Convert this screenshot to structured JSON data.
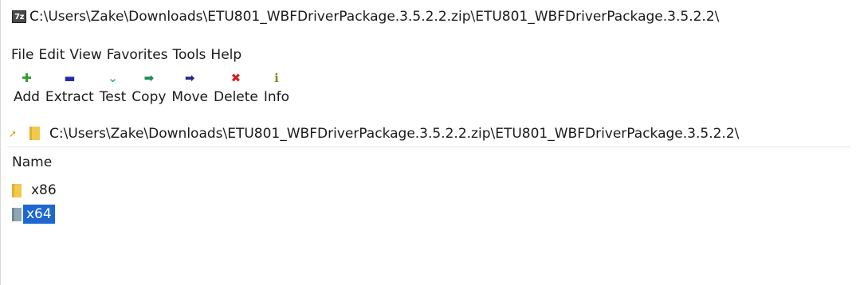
{
  "window": {
    "app_icon_text": "7z",
    "title": "C:\\Users\\Zake\\Downloads\\ETU801_WBFDriverPackage.3.5.2.2.zip\\ETU801_WBFDriverPackage.3.5.2.2\\"
  },
  "menu": {
    "items": [
      "File",
      "Edit",
      "View",
      "Favorites",
      "Tools",
      "Help"
    ]
  },
  "toolbar": {
    "buttons": [
      {
        "label": "Add",
        "icon": "add-icon",
        "glyph": "✚",
        "color": "#2e9e2e"
      },
      {
        "label": "Extract",
        "icon": "extract-icon",
        "glyph": "▬",
        "color": "#1f2ba8"
      },
      {
        "label": "Test",
        "icon": "test-icon",
        "glyph": "⌄",
        "color": "#22b3a4"
      },
      {
        "label": "Copy",
        "icon": "copy-icon",
        "glyph": "➡",
        "color": "#1a8a55"
      },
      {
        "label": "Move",
        "icon": "move-icon",
        "glyph": "➡",
        "color": "#1f2a8a"
      },
      {
        "label": "Delete",
        "icon": "delete-icon",
        "glyph": "✖",
        "color": "#d61f1f"
      },
      {
        "label": "Info",
        "icon": "info-icon",
        "glyph": "ℹ",
        "color": "#8a8a20"
      }
    ]
  },
  "address": {
    "path": "C:\\Users\\Zake\\Downloads\\ETU801_WBFDriverPackage.3.5.2.2.zip\\ETU801_WBFDriverPackage.3.5.2.2\\"
  },
  "filelist": {
    "column_name": "Name",
    "rows": [
      {
        "name": "x86",
        "selected": false
      },
      {
        "name": "x64",
        "selected": true
      }
    ]
  }
}
